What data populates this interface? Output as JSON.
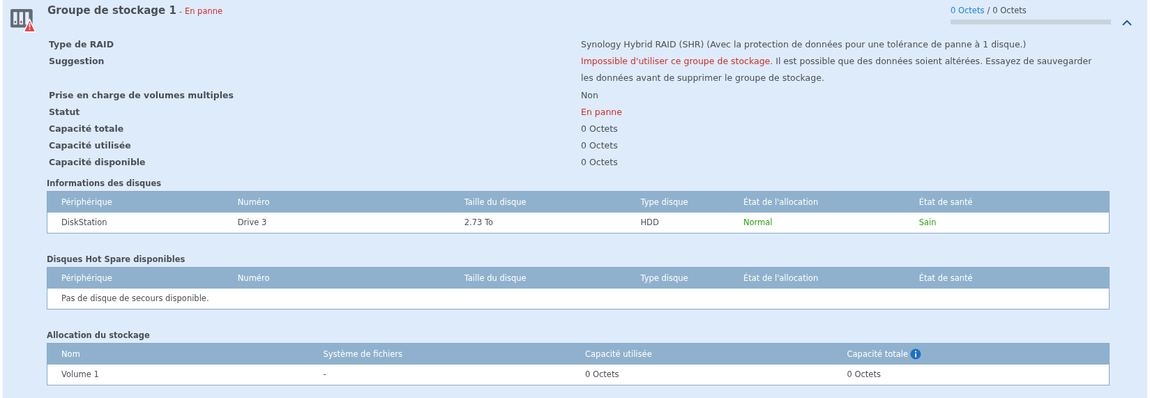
{
  "pool": {
    "title": "Groupe de stockage 1",
    "separator": "-",
    "status": {
      "text": "En panne",
      "color": "#d0302a"
    },
    "usage": {
      "used": "0 Octets",
      "separator": "/",
      "total": "0 Octets"
    },
    "expanded": true
  },
  "properties": [
    {
      "label": "Type de RAID",
      "parts": [
        {
          "text": "Synology Hybrid RAID (SHR) (Avec la protection de données pour une tolérance de panne à 1 disque.)"
        }
      ]
    },
    {
      "label": "Suggestion",
      "parts": [
        {
          "text": "Impossible d'utiliser ce groupe de stockage.",
          "color": "#d0302a"
        },
        {
          "text": " Il est possible que des données soient altérées. Essayez de sauvegarder les données avant de supprimer le groupe de stockage."
        }
      ]
    },
    {
      "label": "Prise en charge de volumes multiples",
      "parts": [
        {
          "text": "Non"
        }
      ]
    },
    {
      "label": "Statut",
      "parts": [
        {
          "text": "En panne",
          "color": "#d0302a"
        }
      ]
    },
    {
      "label": "Capacité totale",
      "parts": [
        {
          "text": "0 Octets"
        }
      ]
    },
    {
      "label": "Capacité utilisée",
      "parts": [
        {
          "text": "0 Octets"
        }
      ]
    },
    {
      "label": "Capacité disponible",
      "parts": [
        {
          "text": "0 Octets"
        }
      ]
    }
  ],
  "sections": [
    {
      "title": "Informations des disques",
      "columns": [
        {
          "label": "Périphérique"
        },
        {
          "label": "Numéro"
        },
        {
          "label": "Taille du disque"
        },
        {
          "label": "Type disque"
        },
        {
          "label": "État de l'allocation"
        },
        {
          "label": "État de santé"
        }
      ],
      "rows": [
        [
          {
            "text": "DiskStation"
          },
          {
            "text": "Drive 3"
          },
          {
            "text": "2.73 To"
          },
          {
            "text": "HDD"
          },
          {
            "text": "Normal",
            "color": "#2ea316"
          },
          {
            "text": "Sain",
            "color": "#2ea316"
          }
        ]
      ]
    },
    {
      "title": "Disques Hot Spare disponibles",
      "columns": [
        {
          "label": "Périphérique"
        },
        {
          "label": "Numéro"
        },
        {
          "label": "Taille du disque"
        },
        {
          "label": "Type disque"
        },
        {
          "label": "État de l'allocation"
        },
        {
          "label": "État de santé"
        }
      ],
      "empty": "Pas de disque de secours disponible."
    },
    {
      "title": "Allocation du stockage",
      "columns": [
        {
          "label": "Nom"
        },
        {
          "label": "Système de fichiers"
        },
        {
          "label": "Capacité utilisée"
        },
        {
          "label": "Capacité totale",
          "info": true
        }
      ],
      "rows": [
        [
          {
            "text": "Volume 1"
          },
          {
            "text": "-"
          },
          {
            "text": "0 Octets"
          },
          {
            "text": "0 Octets"
          }
        ]
      ]
    }
  ]
}
